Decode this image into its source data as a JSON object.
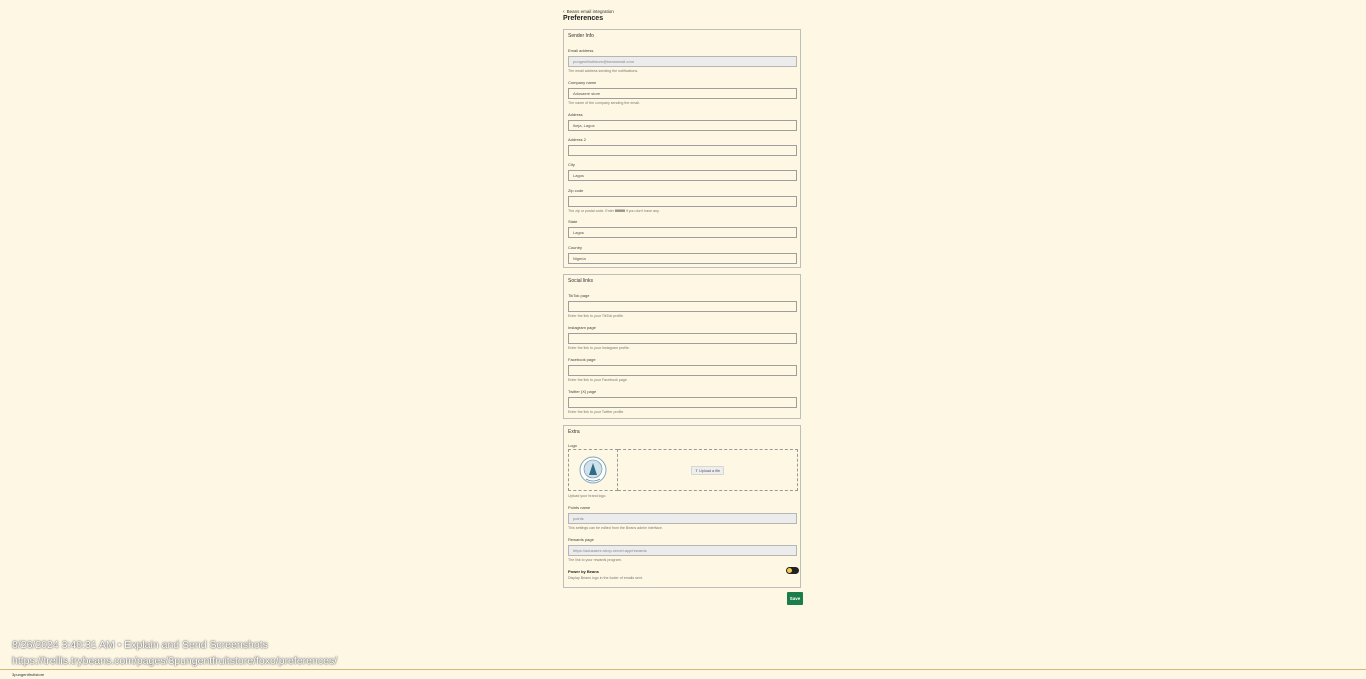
{
  "header": {
    "back_label": "Beans email integration",
    "page_title": "Preferences"
  },
  "sender": {
    "title": "Sender Info",
    "email_label": "Email address",
    "email_value": "pungentfruitstore@beansmail.com",
    "email_help": "The email address sending the notifications.",
    "company_label": "Company name",
    "company_value": "Adusaere store",
    "company_help": "The name of the company sending the email.",
    "address_label": "Address",
    "address_value": "Ikeja, Lagos",
    "address2_label": "Address 2",
    "address2_value": "",
    "city_label": "City",
    "city_value": "Lagos",
    "zip_label": "Zip code",
    "zip_value": "",
    "zip_help_pre": "The zip or postal code. Enter",
    "zip_help_code": "00000",
    "zip_help_post": "if you don't have any.",
    "state_label": "State",
    "state_value": "Lagos",
    "country_label": "Country",
    "country_value": "Nigeria"
  },
  "social": {
    "title": "Social links",
    "tiktok_label": "TikTok page",
    "tiktok_help": "Enter the link to your TikTok profile.",
    "instagram_label": "Instagram page",
    "instagram_help": "Enter the link to your Instagram profile.",
    "facebook_label": "Facebook page",
    "facebook_help": "Enter the link to your Facebook page.",
    "twitter_label": "Twitter (X) page",
    "twitter_help": "Enter the link to your Twitter profile."
  },
  "extra": {
    "title": "Extra",
    "logo_label": "Logo",
    "upload_label": "Upload a file",
    "logo_help": "Upload your brand logo.",
    "points_label": "Points name",
    "points_value": "points",
    "points_help": "This settings can be edited from the Beans admin interface.",
    "rewards_label": "Rewards page",
    "rewards_value": "https://adusaere-shop.vercel.app/rewards",
    "rewards_help": "The link to your rewards program.",
    "power_label": "Power by Beans",
    "power_help": "Display Beans logo in the footer of emails sent.",
    "power_enabled": true
  },
  "actions": {
    "save_label": "Save"
  },
  "overlay": {
    "timestamp_line": "8/26/2024 3:40:31 AM • Explain and Send Screenshots",
    "url_line": "https://trellis.trybeans.com/pages/3pungentfruitstore/foxo/preferences/"
  },
  "footer": {
    "store_label": "3pungentfruitstore"
  },
  "colors": {
    "background": "#fdf7e4",
    "save_button": "#1b7d49",
    "toggle_knob": "#f5c94b",
    "accent": "#d3b87a"
  }
}
